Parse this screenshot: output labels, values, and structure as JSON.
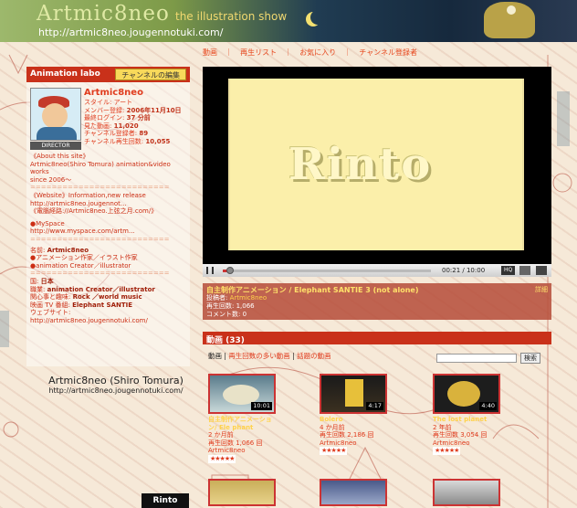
{
  "banner": {
    "title": "Artmic8neo",
    "subtitle": "the illustration show",
    "url": "http://artmic8neo.jougennotuki.com/"
  },
  "topnav": {
    "items": [
      "動画",
      "｜",
      "再生リスト",
      "｜",
      "お気に入り",
      "｜",
      "チャンネル登録者"
    ]
  },
  "profile": {
    "header": "Animation labo",
    "edit_button": "チャンネルの編集",
    "director_badge": "DIRECTOR",
    "name": "Artmic8neo",
    "style": "スタイル: アート",
    "member_since_label": "メンバー登録:",
    "member_since": "2006年11月10日",
    "last_login_label": "最終ログイン:",
    "last_login": "37 分前",
    "views_label": "見た動画:",
    "views": "11,020",
    "subs_label": "チャンネル登録者:",
    "subs": "89",
    "channel_views_label": "チャンネル再生回数:",
    "channel_views": "10,055",
    "about_title": "《About this site》",
    "about_lines": [
      "Artmic8neo(Shiro Tomura) animation&video",
      "works",
      "since 2006～"
    ],
    "divider": "==========================",
    "website_line": "《Website》Information,new release",
    "website_url": "http://artmic8neo.jougennot...",
    "website_alt": "《電腦経路://Artmic8neo.上弦之月.com/》",
    "myspace_label": "●MySpace",
    "myspace_url": "http://www.myspace.com/artm...",
    "name_label": "名前:",
    "name_value": "Artmic8neo",
    "role1": "●アニメーション作家／イラスト作家",
    "role2": "●animation Creator／illustrator",
    "country_label": "国:",
    "country": "日本",
    "job_label": "職業:",
    "job": "animation Creator／illustrator",
    "interest_label": "関心事と趣味:",
    "interest": "Rock ／world music",
    "movies_label": "映画 TV 番組:",
    "movies": "Elephant SANTIE",
    "web_label": "ウェブサイト:",
    "web_url": "http://artmic8neo.jougennotuki.com/"
  },
  "signature": {
    "name": "Artmic8neo (Shiro Tomura)",
    "url": "http://artmic8neo.jougennotuki.com/"
  },
  "player": {
    "logo": "Rinto",
    "time": "00:21 / 10:00",
    "progress": 0.035,
    "hq_label": "HQ"
  },
  "current_video": {
    "title": "自主制作アニメーション / Elephant SANTIE 3 (not alone)",
    "more": "詳細",
    "poster_label": "投稿者:",
    "poster": "Artmic8neo",
    "views_label": "再生回数:",
    "views": "1,066",
    "comments_label": "コメント数:",
    "comments": "0"
  },
  "videos": {
    "header": "動画 (33)",
    "tab_all": "動画",
    "sep": "|",
    "tab_popular": "再生回数の多い動画",
    "tab_recent": "話題の動画",
    "search_button": "検索",
    "items": [
      {
        "title": "自主制作アニメーション/ Ele phant",
        "age": "2 か月前",
        "views": "再生回数 1,066 回",
        "channel": "Artmic8neo",
        "duration": "10:01",
        "stars": "★★★★★"
      },
      {
        "title": "Bolero",
        "age": "4 か月前",
        "views": "再生回数 2,186 回",
        "channel": "Artmic8neo",
        "duration": "4:17",
        "stars": "★★★★★"
      },
      {
        "title": "The lost planet",
        "age": "2 年前",
        "views": "再生回数 3,054 回",
        "channel": "Artmic8neo",
        "duration": "4:40",
        "stars": "★★★★★"
      }
    ]
  },
  "bottom_thumb": "Rinto",
  "colors": {
    "accent": "#c9311a",
    "link": "#e03c1e",
    "highlight": "#ffd24a"
  }
}
